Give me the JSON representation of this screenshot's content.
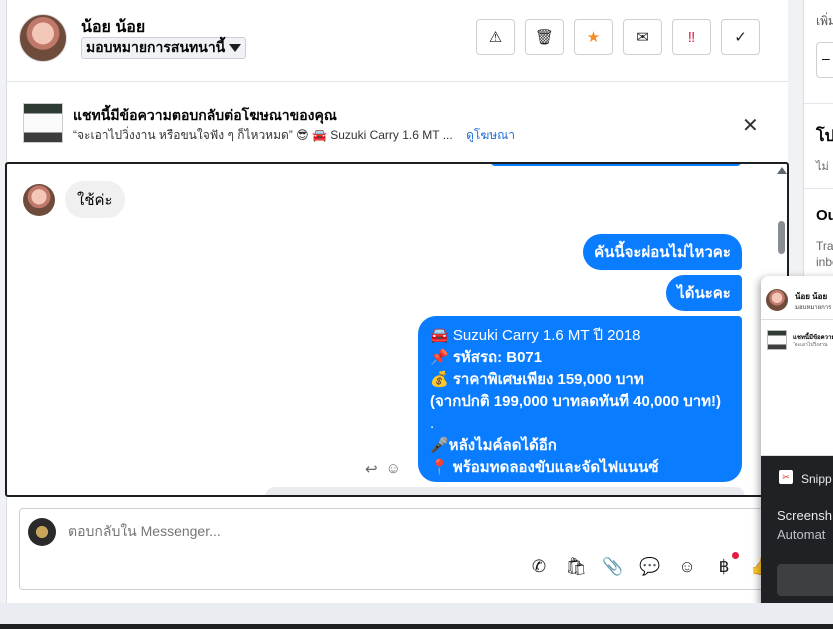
{
  "header": {
    "contact_name": "น้อย น้อย",
    "assign_label": "มอบหมายการสนทนานี้",
    "toolbar": [
      {
        "name": "spam-button",
        "glyph": "⚠",
        "color": "#1c1e21"
      },
      {
        "name": "delete-button",
        "glyph": "🗑",
        "color": "#1c1e21"
      },
      {
        "name": "star-button",
        "glyph": "★",
        "color": "#f28c28"
      },
      {
        "name": "mark-unread-button",
        "glyph": "✉",
        "color": "#1c1e21"
      },
      {
        "name": "important-button",
        "glyph": "‼",
        "color": "#e41e3f"
      },
      {
        "name": "done-button",
        "glyph": "✓",
        "color": "#1c1e21"
      }
    ]
  },
  "ad_banner": {
    "title": "แชทนี้มีข้อความตอบกลับต่อโฆษณาของคุณ",
    "subtitle": "“จะเอาไปวิ่งงาน หรือขนใจฟัง ๆ ก็ไหวหมด” 😎 🚘 Suzuki Carry 1.6 MT ...",
    "link": "ดูโฆษณา",
    "close": "✕"
  },
  "messages": {
    "incoming_1": "ใช้ค่ะ",
    "outgoing_1": "คันนี้จะผ่อนไม่ไหวคะ",
    "outgoing_2": "ได้นะคะ",
    "outgoing_3": [
      "🚘 Suzuki Carry 1.6 MT ปี 2018",
      "📌 รหัสรถ: B071",
      "💰 ราคาพิเศษเพียง 159,000 บาท",
      "(จากปกติ 199,000 บาทลดทันที 40,000 บาท!)",
      ".",
      "🎤หลังไมค์ลดได้อีก",
      "📍 พร้อมทดลองขับและจัดไฟแนนซ์"
    ]
  },
  "composer": {
    "placeholder": "ตอบกลับใน Messenger...",
    "icons": [
      "phone-icon",
      "shopping-bag-icon",
      "paperclip-icon",
      "chat-bubble-icon",
      "emoji-icon",
      "baht-icon",
      "thumbs-up-icon"
    ]
  },
  "right_panel": {
    "top_text": "เพิ่ม",
    "select_text": "–",
    "section1_title": "โป",
    "section1_sub": "ไม่",
    "section2_title": "Ou",
    "section2_sub_1": "Trac",
    "section2_sub_2": "inbo"
  },
  "popup": {
    "mini_name": "น้อย น้อย",
    "mini_select": "มอบหมายการ",
    "mini_ad": "แชทนี้มีข้อความ",
    "mini_ad2": "“จะเอาไปวิ่งงาน",
    "snip_label": "Snipp",
    "title": "Screensh",
    "subtitle": "Automat"
  }
}
